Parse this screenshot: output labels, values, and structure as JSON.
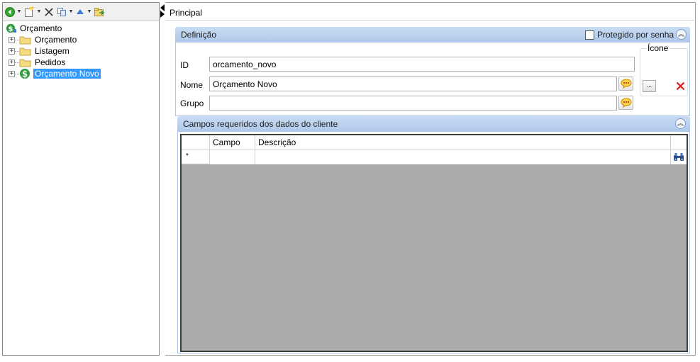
{
  "toolbar": {
    "icons": [
      "back-icon",
      "new-item-icon",
      "delete-icon",
      "copy-icon",
      "move-up-icon",
      "export-icon"
    ]
  },
  "tree": {
    "root": {
      "label": "Orçamento",
      "icon": "money-icon"
    },
    "children": [
      {
        "label": "Orçamento",
        "icon": "folder-icon",
        "selected": false
      },
      {
        "label": "Listagem",
        "icon": "folder-icon",
        "selected": false
      },
      {
        "label": "Pedidos",
        "icon": "folder-icon",
        "selected": false
      },
      {
        "label": "Orçamento Novo",
        "icon": "money-icon",
        "selected": true
      }
    ]
  },
  "tabs": {
    "principal": "Principal"
  },
  "definicao": {
    "title": "Definição",
    "protected_label": "Protegido por senha",
    "protected_checked": false,
    "id_label": "ID",
    "id_value": "orcamento_novo",
    "nome_label": "Nome",
    "nome_value": "Orçamento Novo",
    "grupo_label": "Grupo",
    "grupo_value": "",
    "icone_label": "Ícone",
    "browse_label": "..."
  },
  "campos": {
    "title": "Campos requeridos dos dados do cliente",
    "columns": [
      "Campo",
      "Descrição"
    ],
    "new_row_marker": "*"
  },
  "colors": {
    "header_gradient_top": "#c9dcf2",
    "header_gradient_bottom": "#aec8ea",
    "selection": "#3399ff",
    "grid_background": "#ababab"
  }
}
